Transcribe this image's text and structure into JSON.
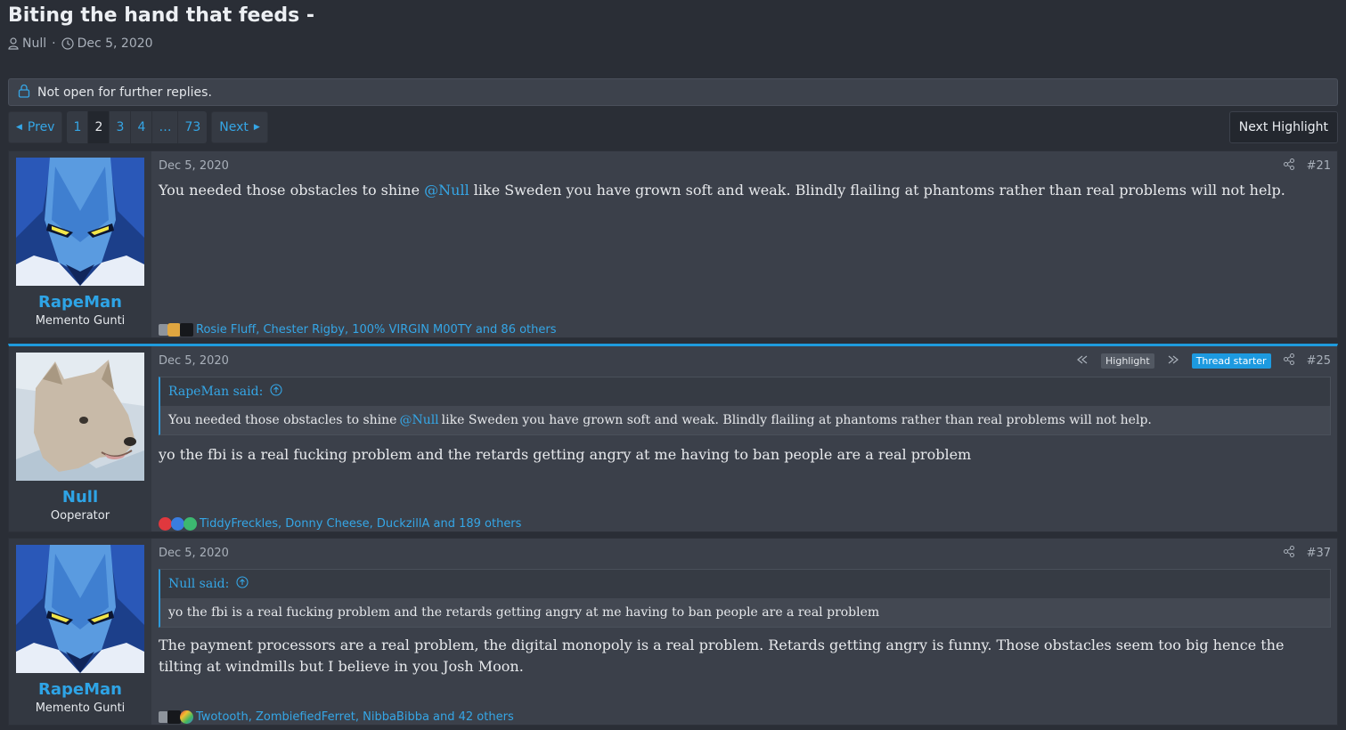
{
  "thread": {
    "title": "Biting the hand that feeds -",
    "author": "Null",
    "date": "Dec 5, 2020",
    "meta_sep": "·"
  },
  "notice": {
    "text": "Not open for further replies."
  },
  "pagenav": {
    "prev": "Prev",
    "next": "Next",
    "pages": [
      "1",
      "2",
      "3",
      "4",
      "…",
      "73"
    ],
    "current": "2",
    "next_highlight": "Next Highlight"
  },
  "posts": [
    {
      "user": "RapeMan",
      "user_title": "Memento Gunti",
      "date": "Dec 5, 2020",
      "number": "#21",
      "text_before": "You needed those obstacles to shine ",
      "mention": "@Null",
      "text_after": " like Sweden you have grown soft and weak. Blindly flailing at phantoms rather than real problems will not help.",
      "reactions": "Rosie Fluff, Chester Rigby, 100% VIRGIN M00TY and 86 others"
    },
    {
      "user": "Null",
      "user_title": "Ooperator",
      "date": "Dec 5, 2020",
      "number": "#25",
      "highlight_label": "Highlight",
      "starter_label": "Thread starter",
      "quote_author": "RapeMan said:",
      "quote_before": "You needed those obstacles to shine ",
      "quote_mention": "@Null",
      "quote_after": " like Sweden you have grown soft and weak. Blindly flailing at phantoms rather than real problems will not help.",
      "text": "yo the fbi is a real fucking problem and the retards getting angry at me having to ban people are a real problem",
      "reactions": "TiddyFreckles, Donny Cheese, DuckzillA and 189 others"
    },
    {
      "user": "RapeMan",
      "user_title": "Memento Gunti",
      "date": "Dec 5, 2020",
      "number": "#37",
      "quote_author": "Null said:",
      "quote_text": "yo the fbi is a real fucking problem and the retards getting angry at me having to ban people are a real problem",
      "text": "The payment processors are a real problem, the digital monopoly is a real problem. Retards getting angry is funny. Those obstacles seem too big hence the tilting at windmills but I believe in you Josh Moon.",
      "reactions": "Twotooth, ZombiefiedFerret, NibbaBibba and 42 others"
    }
  ],
  "icons": [
    "user-icon",
    "clock-icon",
    "lock-icon",
    "share-icon",
    "jump-up-icon",
    "prev-highlight-icon",
    "next-highlight-icon"
  ],
  "colors": {
    "accent": "#1f9bdd",
    "link": "#35a6e6",
    "background": "#2a2e36",
    "post": "#3b404a"
  }
}
